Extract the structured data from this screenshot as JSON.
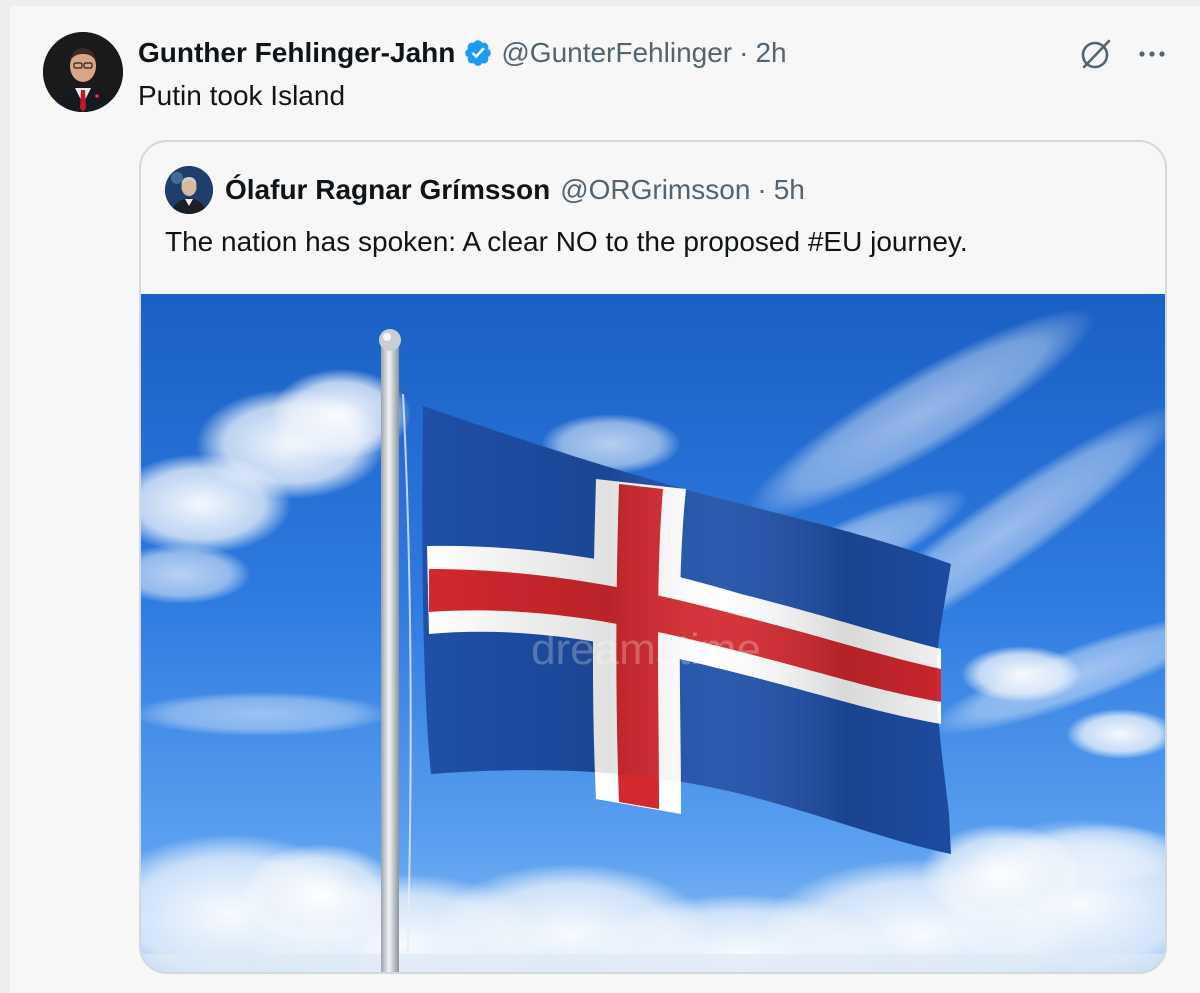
{
  "tweet": {
    "author_name": "Gunther Fehlinger-Jahn",
    "handle": "@GunterFehlinger",
    "separator": "·",
    "time": "2h",
    "text": "Putin took Island",
    "verified": true
  },
  "quoted_tweet": {
    "author_name": "Ólafur Ragnar Grímsson",
    "handle": "@ORGrimsson",
    "separator": "·",
    "time": "5h",
    "text": "The nation has spoken: A clear NO to the proposed #EU journey.",
    "media_watermark": "dreamstime"
  },
  "icons": {
    "verified": "verified-badge-icon",
    "grok": "grok-icon",
    "more": "more-options-icon"
  },
  "colors": {
    "verified_blue": "#1d9bf0",
    "text_primary": "#0f1419",
    "text_secondary": "#536471",
    "card_border": "#cfd9de",
    "flag_blue": "#1f4fa8",
    "flag_red": "#d2282e",
    "flag_white": "#ffffff"
  }
}
